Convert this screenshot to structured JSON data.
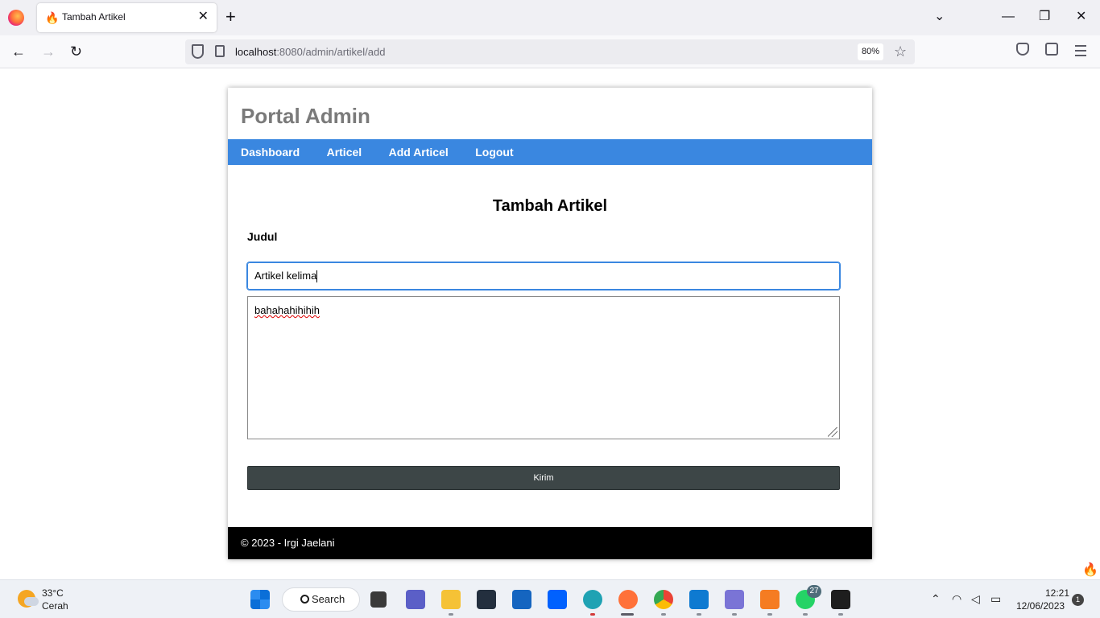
{
  "browser": {
    "tab_title": "Tambah Artikel",
    "url_host": "localhost",
    "url_rest": ":8080/admin/artikel/add",
    "zoom": "80%"
  },
  "page": {
    "site_title": "Portal Admin",
    "nav": [
      "Dashboard",
      "Articel",
      "Add Articel",
      "Logout"
    ],
    "heading": "Tambah Artikel",
    "judul_label": "Judul",
    "judul_value": "Artikel kelima",
    "isi_value": "bahahahihihih",
    "submit_label": "Kirim",
    "footer": "© 2023 - Irgi Jaelani"
  },
  "taskbar": {
    "temperature": "33°C",
    "weather": "Cerah",
    "search_label": "Search",
    "whatsapp_badge": "27",
    "time": "12:21",
    "date": "12/06/2023",
    "notifications": "1",
    "apps": [
      "start-icon",
      "task-view-icon",
      "teams-icon",
      "file-explorer-icon",
      "amazon-icon",
      "store-icon",
      "dropbox-icon",
      "edge-icon",
      "firefox-icon",
      "chrome-icon",
      "vscode-icon",
      "git-icon",
      "xampp-icon",
      "whatsapp-icon",
      "terminal-icon"
    ]
  }
}
